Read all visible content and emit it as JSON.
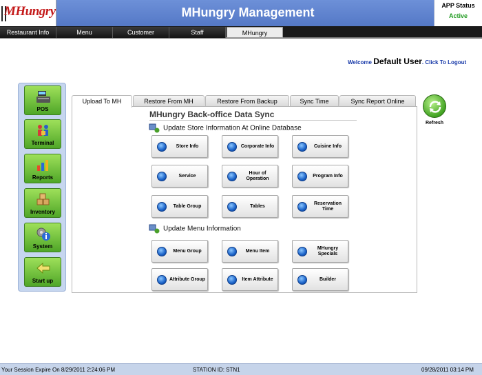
{
  "header": {
    "logo": "MHungry",
    "title": "MHungry Management",
    "status_label": "APP Status",
    "status_value": "Active",
    "status_color": "#1f9a1f",
    "brand_color": "#5478c6"
  },
  "nav": {
    "tabs": [
      {
        "label": "Restaurant Info"
      },
      {
        "label": "Menu"
      },
      {
        "label": "Customer"
      },
      {
        "label": "Staff"
      },
      {
        "label": "MHungry",
        "active": true
      }
    ]
  },
  "welcome": {
    "prefix": "Welcome",
    "user": "Default User",
    "logout": ". Click To Logout"
  },
  "sidebar": {
    "items": [
      {
        "label": "POS",
        "icon": "register-icon"
      },
      {
        "label": "Terminal",
        "icon": "people-icon"
      },
      {
        "label": "Reports",
        "icon": "chart-icon"
      },
      {
        "label": "Inventory",
        "icon": "boxes-icon"
      },
      {
        "label": "System",
        "icon": "gear-info-icon"
      },
      {
        "label": "Start up",
        "icon": "arrow-left-icon"
      }
    ]
  },
  "tabs": [
    {
      "label": "Upload To MH",
      "active": true
    },
    {
      "label": "Restore From MH"
    },
    {
      "label": "Restore From Backup"
    },
    {
      "label": "Sync Time"
    },
    {
      "label": "Sync Report Online"
    }
  ],
  "main": {
    "title": "MHungry Back-office Data Sync",
    "store_heading": "Update Store Information At Online Database",
    "menu_heading": "Update Menu Information",
    "store_buttons": [
      "Store Info",
      "Corporate Info",
      "Cuisine Info",
      "Service",
      "Hour of Operation",
      "Program Info",
      "Table Group",
      "Tables",
      "Reservation Time"
    ],
    "menu_buttons": [
      "Menu Group",
      "Menu Item",
      "MHungry Specials",
      "Attribute Group",
      "Item Attribute",
      "Builder"
    ]
  },
  "refresh": {
    "label": "Refresh"
  },
  "footer": {
    "session": "Your Session Expire On 8/29/2011 2:24:06 PM",
    "station": "STATION ID: STN1",
    "datetime": "09/28/2011  03:14 PM"
  }
}
